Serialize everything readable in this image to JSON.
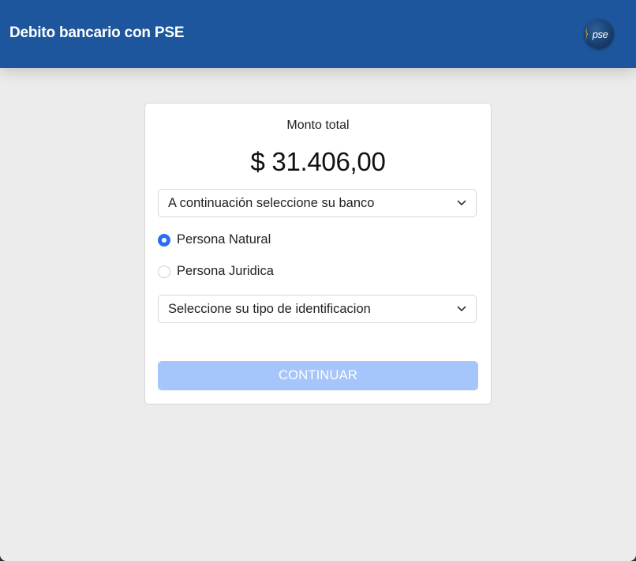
{
  "header": {
    "title": "Debito bancario con PSE",
    "logo_text": "pse"
  },
  "payment": {
    "amount_label": "Monto total",
    "amount_value": "$ 31.406,00"
  },
  "bank_select": {
    "value": "A continuación seleccione su banco"
  },
  "person_type": {
    "options": [
      {
        "label": "Persona Natural",
        "checked": true
      },
      {
        "label": "Persona Juridica",
        "checked": false
      }
    ]
  },
  "id_type_select": {
    "value": "Seleccione su tipo de identificacion"
  },
  "continue_button": {
    "label": "CONTINUAR",
    "enabled": false
  },
  "colors": {
    "header_bg": "#1d569c",
    "page_bg": "#ececec",
    "radio_accent": "#2a6ef0",
    "button_disabled": "#a6c5fb"
  }
}
